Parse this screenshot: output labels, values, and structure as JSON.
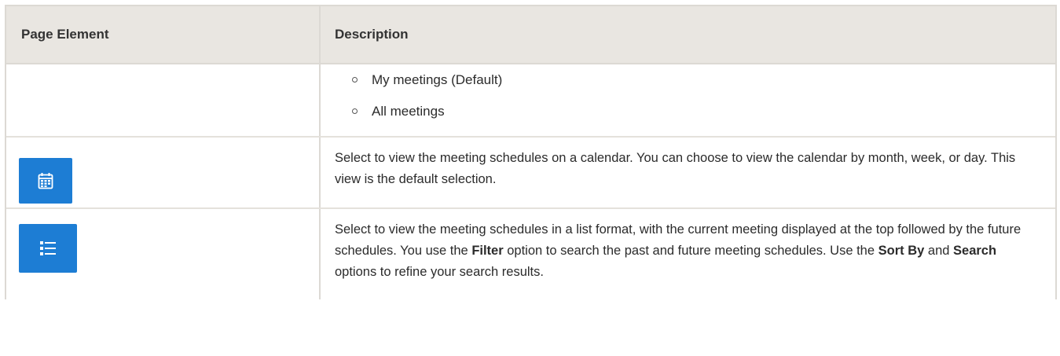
{
  "table": {
    "header": {
      "col1": "Page Element",
      "col2": "Description"
    },
    "rows": [
      {
        "bullets": [
          "My meetings (Default)",
          "All meetings"
        ]
      },
      {
        "icon": "calendar-icon",
        "description": "Select to view the meeting schedules on a calendar. You can choose to view the calendar by month, week, or day. This view is the default selection."
      },
      {
        "icon": "list-view-icon",
        "description_parts": {
          "p1": "Select to view the meeting schedules in a list format, with the current meeting displayed at the top followed by the future schedules. You use the ",
          "b1": "Filter",
          "p2": " option to search the past and future meeting schedules. Use the ",
          "b2": "Sort By",
          "p3": " and ",
          "b3": "Search",
          "p4": " options to refine your search results."
        }
      }
    ]
  },
  "colors": {
    "header_bg": "#e9e6e1",
    "icon_bg": "#1d7dd4",
    "border": "#dcd9d4"
  }
}
